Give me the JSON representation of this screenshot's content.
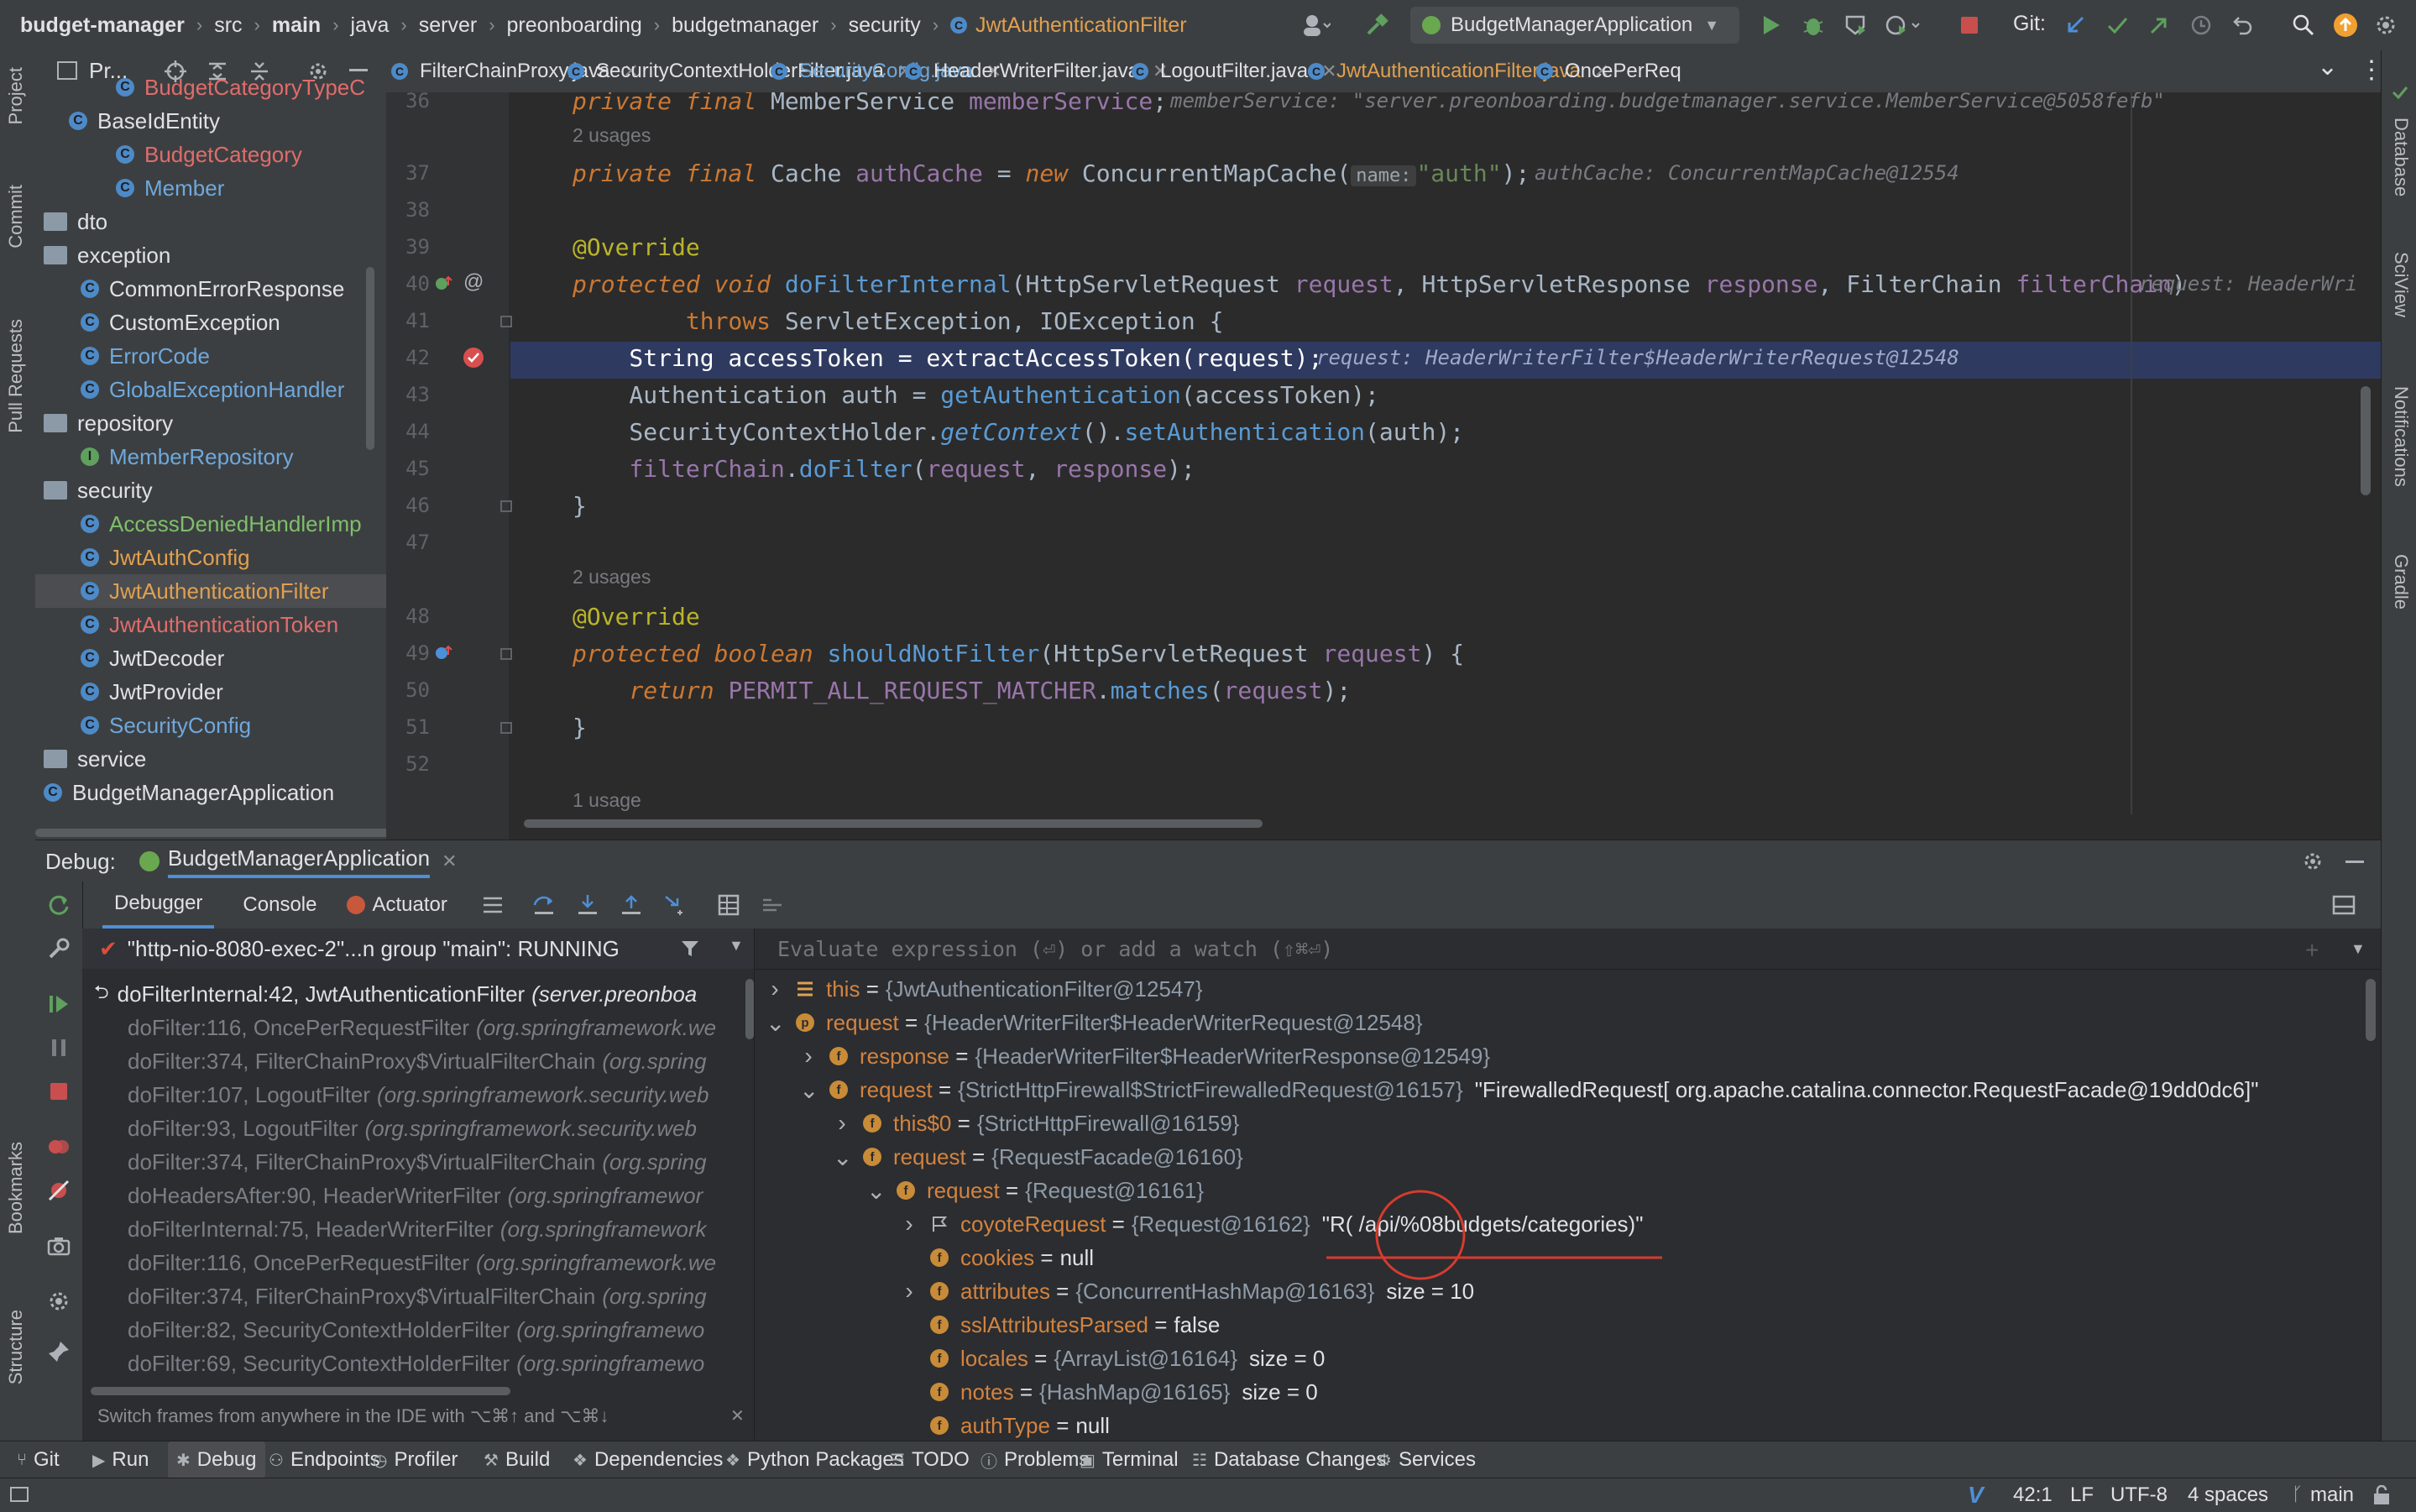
{
  "breadcrumbs": [
    "budget-manager",
    "src",
    "main",
    "java",
    "server",
    "preonboarding",
    "budgetmanager",
    "security",
    "JwtAuthenticationFilter"
  ],
  "run_config": "BudgetManagerApplication",
  "git_label": "Git:",
  "left_strip": [
    "Project",
    "Commit",
    "Pull Requests",
    "Bookmarks",
    "Structure"
  ],
  "right_strip": [
    "Database",
    "SciView",
    "Notifications",
    "Gradle"
  ],
  "project_panel": {
    "title": "Pr...",
    "items": [
      {
        "label": "BudgetCategoryTypeC",
        "kind": "class",
        "color": "#e06c6c"
      },
      {
        "label": "BaseIdEntity",
        "kind": "class",
        "color": "#dfe1e5"
      },
      {
        "label": "BudgetCategory",
        "kind": "class",
        "color": "#e06c6c"
      },
      {
        "label": "Member",
        "kind": "class",
        "color": "#6fa8dc"
      },
      {
        "label": "dto",
        "kind": "folder",
        "color": "#dfe1e5"
      },
      {
        "label": "exception",
        "kind": "folder",
        "color": "#dfe1e5"
      },
      {
        "label": "CommonErrorResponse",
        "kind": "class",
        "color": "#dfe1e5"
      },
      {
        "label": "CustomException",
        "kind": "class",
        "color": "#dfe1e5"
      },
      {
        "label": "ErrorCode",
        "kind": "class",
        "color": "#6fa8dc"
      },
      {
        "label": "GlobalExceptionHandler",
        "kind": "class",
        "color": "#6fa8dc"
      },
      {
        "label": "repository",
        "kind": "folder",
        "color": "#dfe1e5"
      },
      {
        "label": "MemberRepository",
        "kind": "interface",
        "color": "#6fa8dc"
      },
      {
        "label": "security",
        "kind": "folder",
        "color": "#dfe1e5"
      },
      {
        "label": "AccessDeniedHandlerImp",
        "kind": "class",
        "color": "#7fbf6a"
      },
      {
        "label": "JwtAuthConfig",
        "kind": "class",
        "color": "#e0a050"
      },
      {
        "label": "JwtAuthenticationFilter",
        "kind": "class",
        "color": "#e0a050"
      },
      {
        "label": "JwtAuthenticationToken",
        "kind": "class",
        "color": "#e06c6c"
      },
      {
        "label": "JwtDecoder",
        "kind": "class",
        "color": "#dfe1e5"
      },
      {
        "label": "JwtProvider",
        "kind": "class",
        "color": "#dfe1e5"
      },
      {
        "label": "SecurityConfig",
        "kind": "class",
        "color": "#6fa8dc"
      },
      {
        "label": "service",
        "kind": "folder",
        "color": "#dfe1e5"
      },
      {
        "label": "BudgetManagerApplication",
        "kind": "class",
        "color": "#dfe1e5"
      }
    ]
  },
  "editor_tabs": [
    {
      "label": "FilterChainProxy.java",
      "color": "#dfe1e5"
    },
    {
      "label": "SecurityContextHolderFilter.java",
      "color": "#dfe1e5"
    },
    {
      "label": "SecurityConfig.java",
      "color": "#6fa8dc"
    },
    {
      "label": "HeaderWriterFilter.java",
      "color": "#dfe1e5"
    },
    {
      "label": "LogoutFilter.java",
      "color": "#dfe1e5"
    },
    {
      "label": "JwtAuthenticationFilter.java",
      "color": "#e0a050"
    },
    {
      "label": "OncePerReq",
      "color": "#dfe1e5"
    }
  ],
  "editor": {
    "line_numbers": [
      "36",
      "37",
      "38",
      "39",
      "40",
      "41",
      "42",
      "43",
      "44",
      "45",
      "46",
      "47",
      "48",
      "49",
      "50",
      "51",
      "52"
    ],
    "usages_1": "2 usages",
    "usages_2": "2 usages",
    "usages_3": "1 usage",
    "l36_inline": "memberService: \"server.preonboarding.budgetmanager.service.MemberService@5058fefb\"",
    "l37_param": "name:",
    "l37_inline": "authCache: ConcurrentMapCache@12554",
    "l40_inline": "request: HeaderWri",
    "l42_inline": "request: HeaderWriterFilter$HeaderWriterRequest@12548"
  },
  "debug": {
    "label": "Debug:",
    "session": "BudgetManagerApplication",
    "tabs": [
      "Debugger",
      "Console",
      "Actuator"
    ],
    "thread": "\"http-nio-8080-exec-2\"...n group \"main\": RUNNING",
    "watch_placeholder": "Evaluate expression (⏎) or add a watch (⇧⌘⏎)",
    "frames": [
      {
        "method": "doFilterInternal:42, JwtAuthenticationFilter",
        "pkg": "(server.preonboa",
        "current": true
      },
      {
        "method": "doFilter:116, OncePerRequestFilter",
        "pkg": "(org.springframework.we"
      },
      {
        "method": "doFilter:374, FilterChainProxy$VirtualFilterChain",
        "pkg": "(org.spring"
      },
      {
        "method": "doFilter:107, LogoutFilter",
        "pkg": "(org.springframework.security.web"
      },
      {
        "method": "doFilter:93, LogoutFilter",
        "pkg": "(org.springframework.security.web"
      },
      {
        "method": "doFilter:374, FilterChainProxy$VirtualFilterChain",
        "pkg": "(org.spring"
      },
      {
        "method": "doHeadersAfter:90, HeaderWriterFilter",
        "pkg": "(org.springframewor"
      },
      {
        "method": "doFilterInternal:75, HeaderWriterFilter",
        "pkg": "(org.springframework"
      },
      {
        "method": "doFilter:116, OncePerRequestFilter",
        "pkg": "(org.springframework.we"
      },
      {
        "method": "doFilter:374, FilterChainProxy$VirtualFilterChain",
        "pkg": "(org.spring"
      },
      {
        "method": "doFilter:82, SecurityContextHolderFilter",
        "pkg": "(org.springframewo"
      },
      {
        "method": "doFilter:69, SecurityContextHolderFilter",
        "pkg": "(org.springframewo"
      }
    ],
    "frames_hint": "Switch frames from anywhere in the IDE with ⌥⌘↑ and ⌥⌘↓",
    "variables": [
      {
        "indent": 0,
        "arrow": ">",
        "icon": "list",
        "name": "this",
        "value": "{JwtAuthenticationFilter@12547}",
        "extra": ""
      },
      {
        "indent": 0,
        "arrow": "v",
        "icon": "p",
        "name": "request",
        "value": "{HeaderWriterFilter$HeaderWriterRequest@12548}",
        "extra": ""
      },
      {
        "indent": 1,
        "arrow": ">",
        "icon": "f",
        "name": "response",
        "value": "{HeaderWriterFilter$HeaderWriterResponse@12549}",
        "extra": ""
      },
      {
        "indent": 1,
        "arrow": "v",
        "icon": "f",
        "name": "request",
        "value": "{StrictHttpFirewall$StrictFirewalledRequest@16157}",
        "extra": "\"FirewalledRequest[ org.apache.catalina.connector.RequestFacade@19dd0dc6]\""
      },
      {
        "indent": 2,
        "arrow": ">",
        "icon": "f",
        "name": "this$0",
        "value": "{StrictHttpFirewall@16159}",
        "extra": ""
      },
      {
        "indent": 2,
        "arrow": "v",
        "icon": "f",
        "name": "request",
        "value": "{RequestFacade@16160}",
        "extra": ""
      },
      {
        "indent": 3,
        "arrow": "v",
        "icon": "f",
        "name": "request",
        "value": "{Request@16161}",
        "extra": ""
      },
      {
        "indent": 4,
        "arrow": ">",
        "icon": "flag",
        "name": "coyoteRequest",
        "value": "{Request@16162}",
        "extra": "\"R( /api/%08budgets/categories)\""
      },
      {
        "indent": 4,
        "arrow": "",
        "icon": "f",
        "name": "cookies",
        "value": "null",
        "extra": ""
      },
      {
        "indent": 4,
        "arrow": ">",
        "icon": "f",
        "name": "attributes",
        "value": "{ConcurrentHashMap@16163}",
        "extra": "size = 10"
      },
      {
        "indent": 4,
        "arrow": "",
        "icon": "f",
        "name": "sslAttributesParsed",
        "value": "false",
        "extra": ""
      },
      {
        "indent": 4,
        "arrow": "",
        "icon": "f",
        "name": "locales",
        "value": "{ArrayList@16164}",
        "extra": "size = 0"
      },
      {
        "indent": 4,
        "arrow": "",
        "icon": "f",
        "name": "notes",
        "value": "{HashMap@16165}",
        "extra": "size = 0"
      },
      {
        "indent": 4,
        "arrow": "",
        "icon": "f",
        "name": "authType",
        "value": "null",
        "extra": ""
      }
    ]
  },
  "bottom_tabs": [
    "Git",
    "Run",
    "Debug",
    "Endpoints",
    "Profiler",
    "Build",
    "Dependencies",
    "Python Packages",
    "TODO",
    "Problems",
    "Terminal",
    "Database Changes",
    "Services"
  ],
  "status": {
    "position": "42:1",
    "line_sep": "LF",
    "encoding": "UTF-8",
    "indent": "4 spaces",
    "branch": "main"
  },
  "colors": {
    "accent": "#4e8fd8",
    "execution_line": "#2f3a60",
    "annotation_circle": "#d63b2f"
  }
}
